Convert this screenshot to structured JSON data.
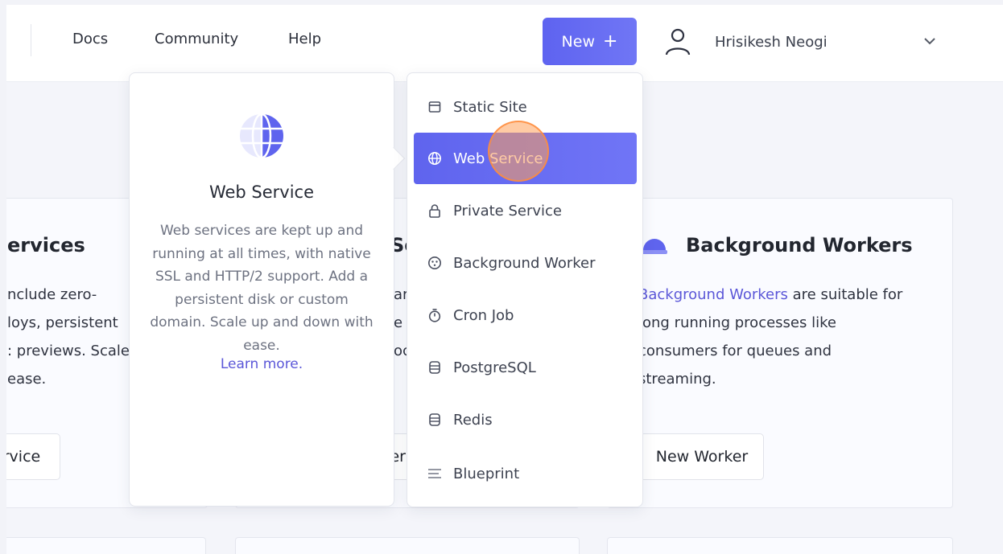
{
  "nav": {
    "docs": "Docs",
    "community": "Community",
    "help": "Help",
    "new_button": "New",
    "new_plus": "+",
    "user_name": "Hrisikesh Neogi"
  },
  "cards": {
    "left": {
      "title": "ervices",
      "lines": [
        "nclude zero-",
        "loys, persistent",
        ": previews. Scale",
        " ease."
      ],
      "button": "rvice"
    },
    "middle": {
      "title_fragment": "Se",
      "lines": [
        "ar",
        "e",
        "oc"
      ],
      "button": "er"
    },
    "right": {
      "title": "Background Workers",
      "line1_link": "Background Workers",
      "line1_rest": " are suitable for",
      "lines": [
        "long running processes like",
        "consumers for queues and",
        "streaming."
      ],
      "button": "New Worker"
    }
  },
  "info_popover": {
    "title": "Web Service",
    "description": "Web services are kept up and running at all times, with native SSL and HTTP/2 support. Add a persistent disk or custom domain. Scale up and down with ease.",
    "learn_more": "Learn more."
  },
  "menu": {
    "items": [
      {
        "label": "Static Site",
        "icon": "static-site-icon"
      },
      {
        "label": "Web Service",
        "icon": "globe-icon"
      },
      {
        "label": "Private Service",
        "icon": "lock-icon"
      },
      {
        "label": "Background Worker",
        "icon": "worker-icon"
      },
      {
        "label": "Cron Job",
        "icon": "stopwatch-icon"
      },
      {
        "label": "PostgreSQL",
        "icon": "database-icon"
      },
      {
        "label": "Redis",
        "icon": "database-icon"
      },
      {
        "label": "Blueprint",
        "icon": "blueprint-icon"
      }
    ],
    "active_index": 1
  },
  "colors": {
    "accent": "#5f64ee",
    "link": "#5b57d8",
    "click_marker": "#ffa05a"
  }
}
